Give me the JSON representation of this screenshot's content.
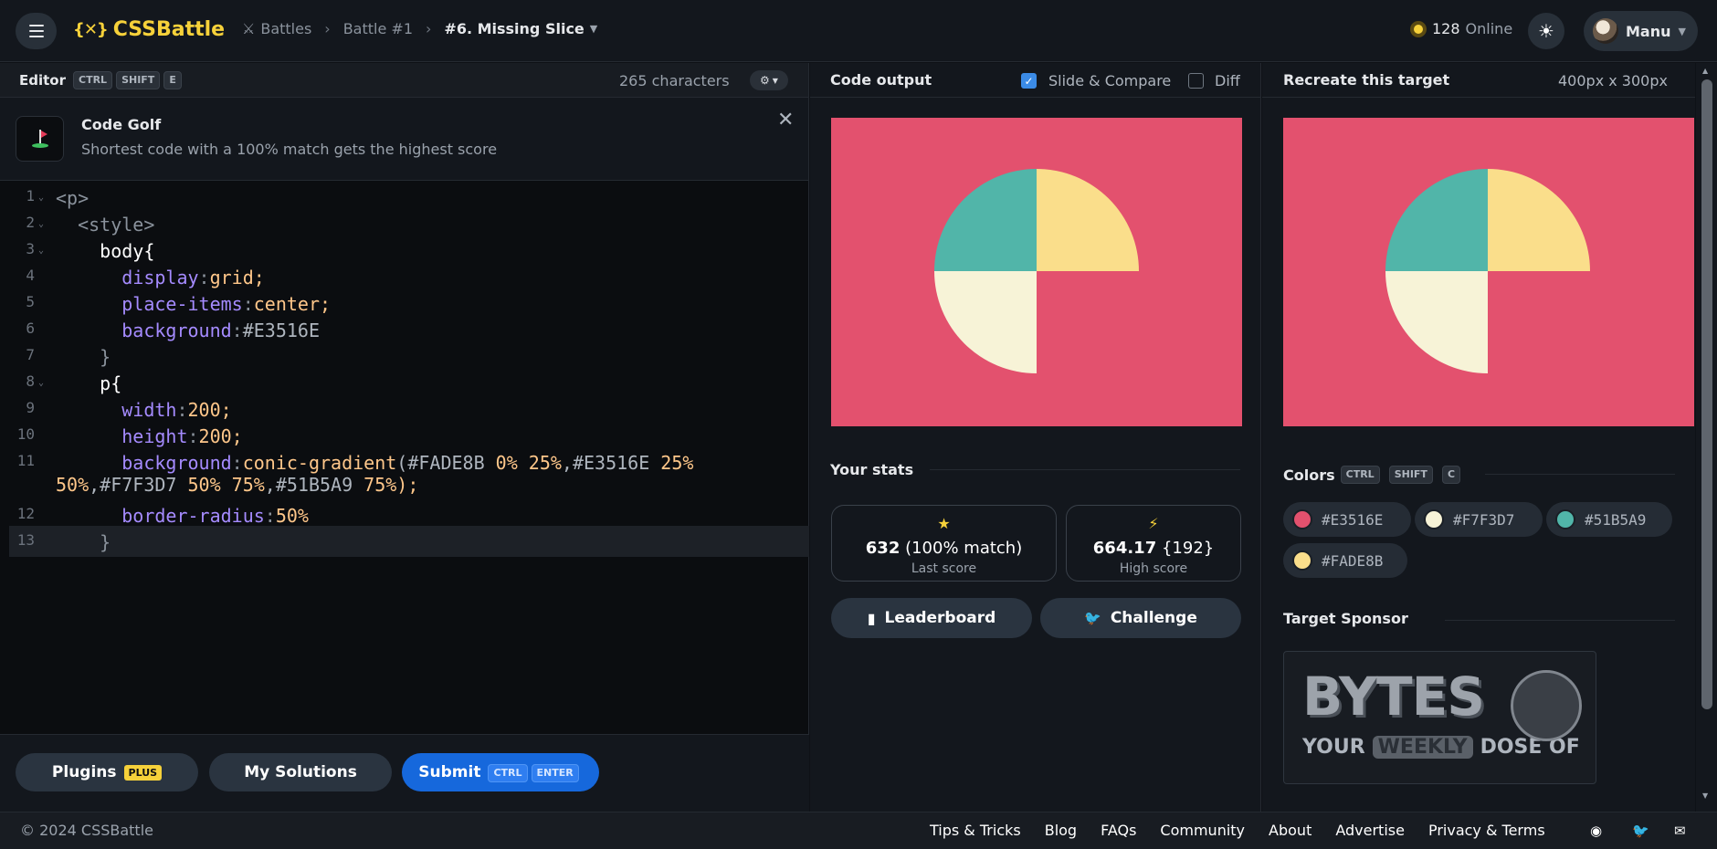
{
  "app": {
    "name": "CSSBattle",
    "logo_mark": "{✕}"
  },
  "breadcrumb": {
    "items": [
      "Battles",
      "Battle #1"
    ],
    "current": "#6. Missing Slice"
  },
  "online": {
    "count": "128",
    "label": "Online"
  },
  "user": {
    "name": "Manu"
  },
  "editor": {
    "title": "Editor",
    "shortcut": [
      "CTRL",
      "SHIFT",
      "E"
    ],
    "chars": "265 characters",
    "tip_title": "Code Golf",
    "tip_text": "Shortest code with a 100% match gets the highest score",
    "lines": [
      {
        "n": "1"
      },
      {
        "n": "2"
      },
      {
        "n": "3"
      },
      {
        "n": "4"
      },
      {
        "n": "5"
      },
      {
        "n": "6"
      },
      {
        "n": "7"
      },
      {
        "n": "8"
      },
      {
        "n": "9"
      },
      {
        "n": "10"
      },
      {
        "n": "11"
      },
      {
        "n": "12"
      },
      {
        "n": "13"
      }
    ],
    "code": {
      "l1": "<p>",
      "l2": "<style>",
      "l3": "body{",
      "l4p": "display",
      "l4v": "grid;",
      "l5p": "place-items",
      "l5v": "center;",
      "l6p": "background",
      "l6v": "#E3516E",
      "l7": "}",
      "l8": "p{",
      "l9p": "width",
      "l9v": "200;",
      "l10p": "height",
      "l10v": "200;",
      "l11p": "background",
      "l11f": "conic-gradient",
      "l11a": "(#FADE8B ",
      "l11b": "0% 25%",
      "l11c": ",#E3516E ",
      "l11d": "25%",
      "l11e": "50%",
      "l11g": ",#F7F3D7 ",
      "l11h": "50% 75%",
      "l11i": ",#51B5A9 ",
      "l11j": "75%",
      "l11k": ");",
      "l12p": "border-radius",
      "l12v": "50%",
      "l13": "}"
    }
  },
  "buttons": {
    "plugins": "Plugins",
    "plus": "PLUS",
    "solutions": "My Solutions",
    "submit": "Submit",
    "submit_keys": [
      "CTRL",
      "ENTER"
    ]
  },
  "output": {
    "title": "Code output",
    "slide": "Slide & Compare",
    "diff": "Diff",
    "stats_title": "Your stats",
    "last_score": "632",
    "last_match": "(100% match)",
    "last_label": "Last score",
    "high_score": "664.17",
    "high_chars": "{192}",
    "high_label": "High score",
    "leaderboard": "Leaderboard",
    "challenge": "Challenge"
  },
  "target": {
    "title": "Recreate this target",
    "size": "400px x 300px",
    "colors_title": "Colors",
    "colors_keys": [
      "CTRL",
      "SHIFT",
      "C"
    ],
    "colors": [
      "#E3516E",
      "#F7F3D7",
      "#51B5A9",
      "#FADE8B"
    ],
    "sponsor_title": "Target Sponsor",
    "sponsor_word": "BYTES",
    "sponsor_your": "YOUR",
    "sponsor_weekly": "WEEKLY",
    "sponsor_dose": "DOSE OF"
  },
  "footer": {
    "copy": "© 2024 CSSBattle",
    "links": [
      "Tips & Tricks",
      "Blog",
      "FAQs",
      "Community",
      "About",
      "Advertise",
      "Privacy & Terms"
    ]
  }
}
